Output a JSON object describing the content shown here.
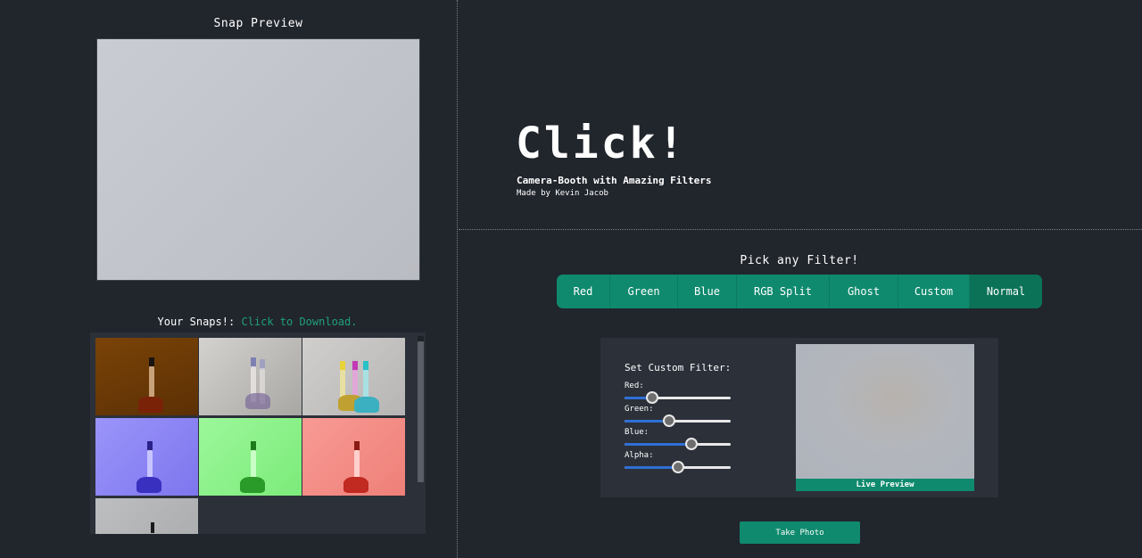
{
  "snap_preview": {
    "title": "Snap Preview"
  },
  "snaps": {
    "title": "Your Snaps!:",
    "download_hint": "Click to Download.",
    "thumbnails": [
      {
        "filter": "orange",
        "bg": "#6b3a06"
      },
      {
        "filter": "ghost",
        "bg": "#b9b8b4"
      },
      {
        "filter": "rgb-split",
        "bg": "#c4c3c2"
      },
      {
        "filter": "blue",
        "bg": "#8c86f6"
      },
      {
        "filter": "green",
        "bg": "#8ef58c"
      },
      {
        "filter": "red",
        "bg": "#f4908a"
      },
      {
        "filter": "normal",
        "bg": "#b3b4b6"
      }
    ]
  },
  "header": {
    "title": "Click!",
    "subtitle": "Camera-Booth with Amazing Filters",
    "author": "Made by Kevin Jacob"
  },
  "filters": {
    "title": "Pick any Filter!",
    "items": [
      {
        "label": "Red"
      },
      {
        "label": "Green"
      },
      {
        "label": "Blue"
      },
      {
        "label": "RGB Split"
      },
      {
        "label": "Ghost"
      },
      {
        "label": "Custom"
      },
      {
        "label": "Normal"
      }
    ],
    "active": "Normal"
  },
  "custom_filter": {
    "title": "Set Custom Filter:",
    "sliders": [
      {
        "label": "Red:",
        "value": 0.26
      },
      {
        "label": "Green:",
        "value": 0.42
      },
      {
        "label": "Blue:",
        "value": 0.63
      },
      {
        "label": "Alpha:",
        "value": 0.5
      }
    ],
    "live_preview_label": "Live Preview"
  },
  "actions": {
    "take_photo": "Take Photo"
  },
  "colors": {
    "accent": "#0f8a6e",
    "link": "#1fa07c",
    "background": "#21252c",
    "panel": "#2b3039",
    "slider_fill": "#2f6fd6"
  }
}
